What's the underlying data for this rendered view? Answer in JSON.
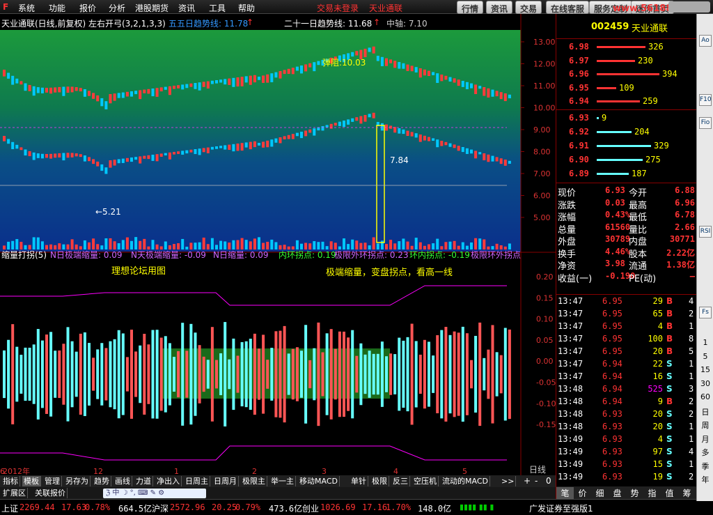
{
  "menu": {
    "items": [
      "系统",
      "功能",
      "报价",
      "分析",
      "港股期货",
      "资讯",
      "工具",
      "帮助"
    ],
    "ad1": "交易未登录",
    "ad2": "天业通联",
    "buttons": [
      "行情",
      "资讯",
      "交易",
      "在线客服",
      "服务定制",
      "迷你首页"
    ],
    "website": "www.56188.com"
  },
  "chart": {
    "title": "天业通联(日线,前复权) 左右开弓(3,2,1,3,3)",
    "ma_label": "五五日趋势线: 11.78",
    "trend_label": "二十一日趋势线: 11.68",
    "axis_label": "中轴: 7.10",
    "annot_high": "↑",
    "annot_left": "←5.21",
    "annot_mid": "7.84",
    "annot_yellow": "弹阻:10.03",
    "price_ticks": [
      "13.00",
      "12.00",
      "11.00",
      "10.00",
      "9.00",
      "8.00",
      "7.00",
      "6.00",
      "5.00"
    ],
    "osc_title": "缩量打拐(5)",
    "osc_labels": [
      {
        "t": "N日极端缩量: 0.09",
        "c": "#c6f"
      },
      {
        "t": "N天极端缩量: -0.09",
        "c": "#c6f"
      },
      {
        "t": "N日缩量: 0.09",
        "c": "#c6f"
      },
      {
        "t": "内环拐点: 0.19",
        "c": "#3f3"
      },
      {
        "t": "极限外环拐点: 0.23",
        "c": "#c6f"
      },
      {
        "t": "环内拐点: -0.19",
        "c": "#3f3"
      },
      {
        "t": "极限环外拐点",
        "c": "#c6f"
      }
    ],
    "osc_note1": "理想论坛用图",
    "osc_note2": "极端缩量，变盘拐点，看高一线",
    "osc_ticks": [
      "0.20",
      "0.15",
      "0.10",
      "0.05",
      "0.00",
      "-0.05",
      "-0.10",
      "-0.15"
    ],
    "date_labels": [
      "2012年",
      "12",
      "1",
      "2",
      "3",
      "4",
      "5",
      "6"
    ],
    "period": "日线",
    "zoom_buttons": [
      "+",
      "-",
      "0"
    ]
  },
  "tabs": [
    "指标",
    "模板",
    "管理",
    "另存为",
    "趋势",
    "画线",
    "力道",
    "净出入",
    "日周主",
    "日周月",
    "极限主",
    "举一主",
    "移动MACD",
    "单针",
    "极限",
    "反三",
    "空压机",
    "流动的MACD",
    ">>"
  ],
  "subtabs": [
    "扩展区",
    "关联报价"
  ],
  "quote": {
    "code": "002459",
    "name": "天业通联",
    "asks": [
      {
        "p": "6.98",
        "v": "326",
        "w": 70
      },
      {
        "p": "6.97",
        "v": "230",
        "w": 55
      },
      {
        "p": "6.96",
        "v": "394",
        "w": 90
      },
      {
        "p": "6.95",
        "v": "109",
        "w": 28
      },
      {
        "p": "6.94",
        "v": "259",
        "w": 62
      }
    ],
    "bids": [
      {
        "p": "6.93",
        "v": "9",
        "w": 3
      },
      {
        "p": "6.92",
        "v": "204",
        "w": 50
      },
      {
        "p": "6.91",
        "v": "329",
        "w": 78
      },
      {
        "p": "6.90",
        "v": "275",
        "w": 66
      },
      {
        "p": "6.89",
        "v": "187",
        "w": 46
      }
    ],
    "stats": [
      [
        "现价",
        "6.93",
        "今开",
        "6.88"
      ],
      [
        "涨跌",
        "0.03",
        "最高",
        "6.96"
      ],
      [
        "涨幅",
        "0.43%",
        "最低",
        "6.78"
      ],
      [
        "总量",
        "61560",
        "量比",
        "2.66"
      ],
      [
        "外盘",
        "30789",
        "内盘",
        "30771"
      ],
      [
        "换手",
        "4.46%",
        "股本",
        "2.22亿"
      ],
      [
        "净资",
        "3.98",
        "流通",
        "1.38亿"
      ],
      [
        "收益(一)",
        "-0.190",
        "PE(动)",
        "—"
      ]
    ],
    "ticks": [
      [
        "13:47",
        "6.95",
        "29",
        "B",
        "4"
      ],
      [
        "13:47",
        "6.95",
        "65",
        "B",
        "2"
      ],
      [
        "13:47",
        "6.95",
        "4",
        "B",
        "1"
      ],
      [
        "13:47",
        "6.95",
        "100",
        "B",
        "8"
      ],
      [
        "13:47",
        "6.95",
        "20",
        "B",
        "5"
      ],
      [
        "13:47",
        "6.94",
        "22",
        "S",
        "1"
      ],
      [
        "13:47",
        "6.94",
        "16",
        "S",
        "1"
      ],
      [
        "13:48",
        "6.94",
        "525",
        "S",
        "3"
      ],
      [
        "13:48",
        "6.94",
        "9",
        "B",
        "2"
      ],
      [
        "13:48",
        "6.93",
        "20",
        "S",
        "2"
      ],
      [
        "13:48",
        "6.93",
        "20",
        "S",
        "1"
      ],
      [
        "13:49",
        "6.93",
        "4",
        "S",
        "1"
      ],
      [
        "13:49",
        "6.93",
        "97",
        "S",
        "4"
      ],
      [
        "13:49",
        "6.93",
        "15",
        "S",
        "1"
      ],
      [
        "13:49",
        "6.93",
        "19",
        "S",
        "2"
      ]
    ],
    "bottom_tabs": [
      "笔",
      "价",
      "细",
      "盘",
      "势",
      "指",
      "值",
      "筹"
    ]
  },
  "sidebar": [
    "Ao",
    "F10",
    "Fio",
    "RSI",
    "Fs",
    "1",
    "5",
    "15",
    "30",
    "60",
    "日",
    "周",
    "月",
    "多",
    "季",
    "年"
  ],
  "status": {
    "sh_label": "上证",
    "sh_val": "2269.44",
    "sh_chg": "17.63",
    "sh_pct": "0.78%",
    "sh_amt": "664.5亿",
    "hs_label": "沪深",
    "hs_val": "2572.96",
    "hs_chg": "20.25",
    "hs_pct": "0.79%",
    "hs_amt": "473.6亿",
    "cy_label": "创业",
    "cy_val": "1026.69",
    "cy_chg": "17.16",
    "cy_pct": "1.70%",
    "cy_amt": "148.0亿",
    "broker": "广发证券至强版1"
  },
  "colors": {
    "up": "#ff3b3b",
    "down": "#00c8ff",
    "ma": "#ffff00"
  }
}
